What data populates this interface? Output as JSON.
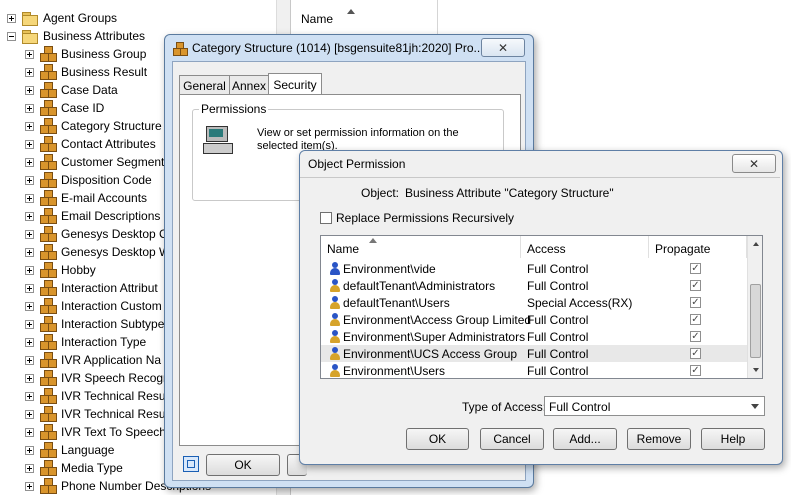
{
  "tree": {
    "items": [
      {
        "label": "Agent Groups",
        "icon": "folder-icon",
        "expander": "plus",
        "level": 0
      },
      {
        "label": "Business Attributes",
        "icon": "folder-icon",
        "expander": "minus",
        "level": 0
      },
      {
        "label": "Business Group",
        "icon": "cubes-icon",
        "expander": "plus",
        "level": 1
      },
      {
        "label": "Business Result",
        "icon": "cubes-icon",
        "expander": "plus",
        "level": 1
      },
      {
        "label": "Case Data",
        "icon": "cubes-icon",
        "expander": "plus",
        "level": 1
      },
      {
        "label": "Case ID",
        "icon": "cubes-icon",
        "expander": "plus",
        "level": 1
      },
      {
        "label": "Category Structure",
        "icon": "cubes-icon",
        "expander": "plus",
        "level": 1
      },
      {
        "label": "Contact Attributes",
        "icon": "cubes-icon",
        "expander": "plus",
        "level": 1
      },
      {
        "label": "Customer Segment",
        "icon": "cubes-icon",
        "expander": "plus",
        "level": 1
      },
      {
        "label": "Disposition Code",
        "icon": "cubes-icon",
        "expander": "plus",
        "level": 1
      },
      {
        "label": "E-mail Accounts",
        "icon": "cubes-icon",
        "expander": "plus",
        "level": 1
      },
      {
        "label": "Email Descriptions",
        "icon": "cubes-icon",
        "expander": "plus",
        "level": 1
      },
      {
        "label": "Genesys Desktop C",
        "icon": "cubes-icon",
        "expander": "plus",
        "level": 1
      },
      {
        "label": "Genesys Desktop W",
        "icon": "cubes-icon",
        "expander": "plus",
        "level": 1
      },
      {
        "label": "Hobby",
        "icon": "cubes-icon",
        "expander": "plus",
        "level": 1
      },
      {
        "label": "Interaction Attribut",
        "icon": "cubes-icon",
        "expander": "plus",
        "level": 1
      },
      {
        "label": "Interaction Custom",
        "icon": "cubes-icon",
        "expander": "plus",
        "level": 1
      },
      {
        "label": "Interaction Subtype",
        "icon": "cubes-icon",
        "expander": "plus",
        "level": 1
      },
      {
        "label": "Interaction Type",
        "icon": "cubes-icon",
        "expander": "plus",
        "level": 1
      },
      {
        "label": "IVR Application Na",
        "icon": "cubes-icon",
        "expander": "plus",
        "level": 1
      },
      {
        "label": "IVR Speech Recogn",
        "icon": "cubes-icon",
        "expander": "plus",
        "level": 1
      },
      {
        "label": "IVR Technical Resu",
        "icon": "cubes-icon",
        "expander": "plus",
        "level": 1
      },
      {
        "label": "IVR Technical Resu",
        "icon": "cubes-icon",
        "expander": "plus",
        "level": 1
      },
      {
        "label": "IVR Text To Speech",
        "icon": "cubes-icon",
        "expander": "plus",
        "level": 1
      },
      {
        "label": "Language",
        "icon": "cubes-icon",
        "expander": "plus",
        "level": 1
      },
      {
        "label": "Media Type",
        "icon": "cubes-icon",
        "expander": "plus",
        "level": 1
      },
      {
        "label": "Phone Number Descriptions",
        "icon": "cubes-icon",
        "expander": "plus",
        "level": 1
      }
    ]
  },
  "list": {
    "name_header": "Name"
  },
  "props_dialog": {
    "title": "Category Structure (1014) [bsgensuite81jh:2020] Pro...",
    "close_glyph": "✕",
    "tabs": [
      {
        "label": "General",
        "active": false
      },
      {
        "label": "Annex",
        "active": false
      },
      {
        "label": "Security",
        "active": true
      }
    ],
    "group_label": "Permissions",
    "description": "View or set permission information on the selected item(s).",
    "ok_label": "OK"
  },
  "perm_dialog": {
    "title": "Object Permission",
    "close_glyph": "✕",
    "object_label": "Object:",
    "object_value": "Business Attribute \"Category Structure\"",
    "replace_label": "Replace Permissions Recursively",
    "columns": {
      "name": "Name",
      "access": "Access",
      "propagate": "Propagate"
    },
    "rows": [
      {
        "name": "Environment\\vide",
        "access": "Full Control",
        "propagate": true,
        "kind": "user"
      },
      {
        "name": "defaultTenant\\Administrators",
        "access": "Full Control",
        "propagate": true,
        "kind": "group"
      },
      {
        "name": "defaultTenant\\Users",
        "access": "Special Access(RX)",
        "propagate": true,
        "kind": "group"
      },
      {
        "name": "Environment\\Access Group Limited",
        "access": "Full Control",
        "propagate": true,
        "kind": "group"
      },
      {
        "name": "Environment\\Super Administrators",
        "access": "Full Control",
        "propagate": true,
        "kind": "group"
      },
      {
        "name": "Environment\\UCS Access Group",
        "access": "Full Control",
        "propagate": true,
        "kind": "group"
      },
      {
        "name": "Environment\\Users",
        "access": "Full Control",
        "propagate": true,
        "kind": "group"
      }
    ],
    "type_label": "Type of Access:",
    "type_value": "Full Control",
    "buttons": {
      "ok": "OK",
      "cancel": "Cancel",
      "add": "Add...",
      "remove": "Remove",
      "help": "Help"
    }
  },
  "colors": {
    "selection": "#e8e8e8",
    "title_bg": "#cfe0f3",
    "client_bg": "#f0f0f0"
  }
}
